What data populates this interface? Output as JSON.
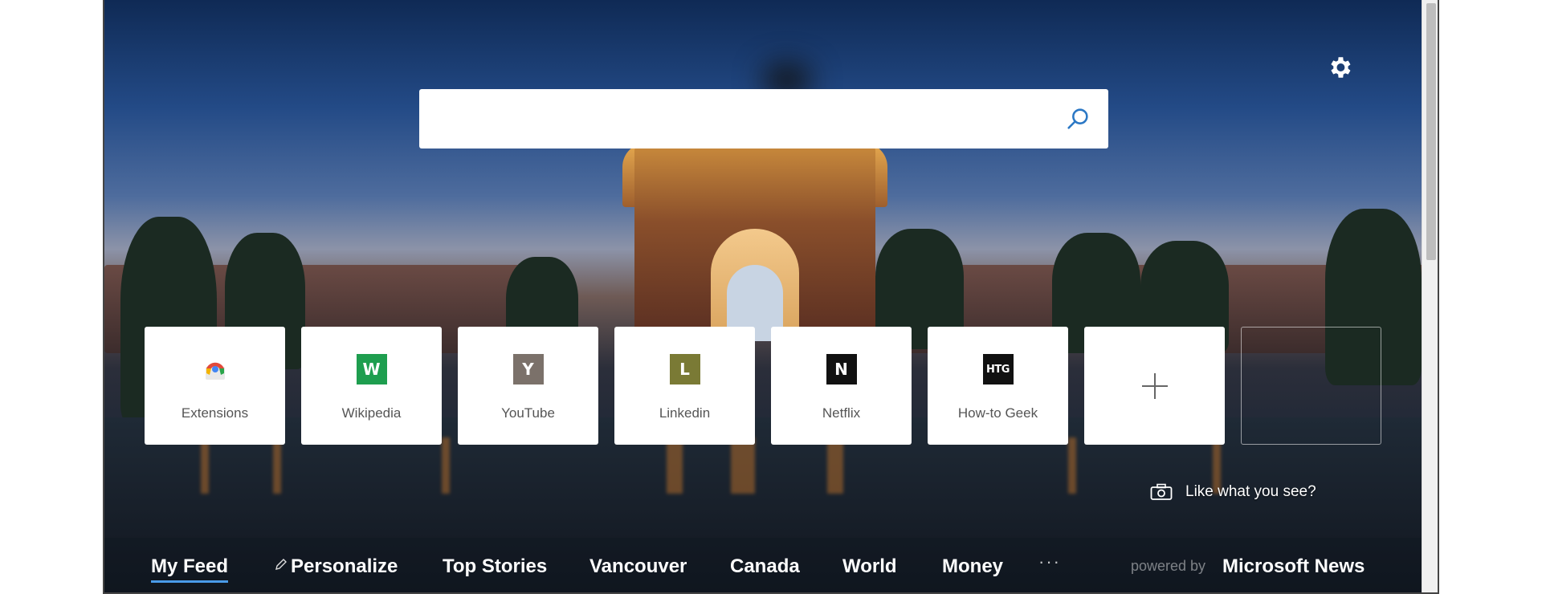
{
  "search": {
    "placeholder": "",
    "value": ""
  },
  "settings": {
    "icon": "gear-icon"
  },
  "tiles": [
    {
      "label": "Extensions",
      "icon": "extensions-icon",
      "glyph": "",
      "color": "#ffffff"
    },
    {
      "label": "Wikipedia",
      "icon": "wikipedia-icon",
      "glyph": "W",
      "color": "#1e9e4f"
    },
    {
      "label": "YouTube",
      "icon": "youtube-icon",
      "glyph": "Y",
      "color": "#7b716a"
    },
    {
      "label": "Linkedin",
      "icon": "linkedin-icon",
      "glyph": "L",
      "color": "#7a7a35"
    },
    {
      "label": "Netflix",
      "icon": "netflix-icon",
      "glyph": "N",
      "color": "#111111"
    },
    {
      "label": "How-to Geek",
      "icon": "howtogeek-icon",
      "glyph": "HTG",
      "color": "#111111"
    }
  ],
  "add_tile": {
    "icon": "plus-icon"
  },
  "like": {
    "label": "Like what you see?",
    "icon": "camera-icon"
  },
  "nav": {
    "items": [
      {
        "label": "My Feed",
        "active": true
      },
      {
        "label": "Personalize",
        "icon": "pencil-icon"
      },
      {
        "label": "Top Stories"
      },
      {
        "label": "Vancouver"
      },
      {
        "label": "Canada"
      },
      {
        "label": "World"
      },
      {
        "label": "Money"
      }
    ],
    "more": "···",
    "powered_by": "powered by",
    "brand": "Microsoft News"
  },
  "colors": {
    "accent": "#4a9be8",
    "search_icon": "#2b78c5"
  }
}
